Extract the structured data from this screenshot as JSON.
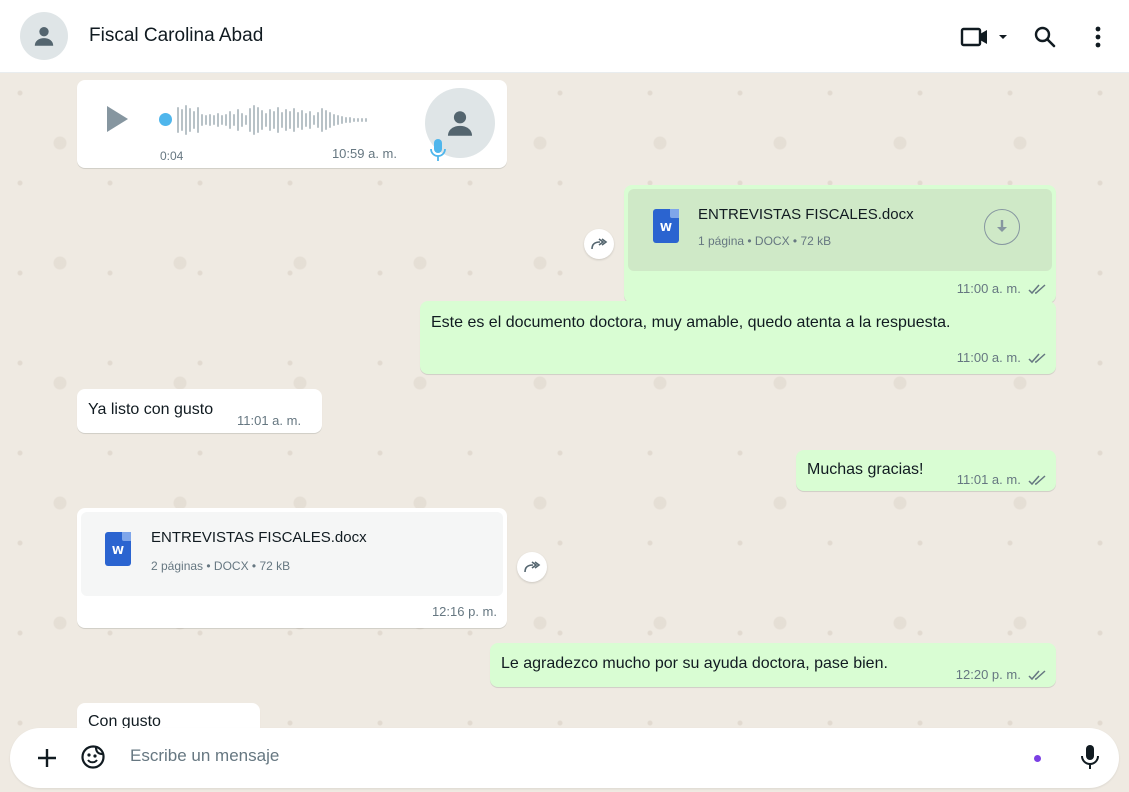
{
  "header": {
    "contact_name": "Fiscal Carolina Abad",
    "icons": [
      "default-avatar-icon",
      "video-call-icon",
      "chevron-down-icon",
      "search-icon",
      "more-vertical-icon"
    ]
  },
  "messages": [
    {
      "type": "audio",
      "direction": "in",
      "duration": "0:04",
      "time": "10:59 a. m."
    },
    {
      "type": "document",
      "direction": "out",
      "file_name": "ENTREVISTAS FISCALES.docx",
      "file_meta": "1 página • DOCX • 72 kB",
      "time": "11:00 a. m."
    },
    {
      "type": "text",
      "direction": "out",
      "text": "Este es el documento doctora, muy amable, quedo atenta a la respuesta.",
      "time": "11:00 a. m."
    },
    {
      "type": "text",
      "direction": "in",
      "text": "Ya listo con gusto",
      "time": "11:01 a. m."
    },
    {
      "type": "text",
      "direction": "out",
      "text": "Muchas gracias!",
      "time": "11:01 a. m."
    },
    {
      "type": "document",
      "direction": "in",
      "file_name": "ENTREVISTAS FISCALES.docx",
      "file_meta": "2 páginas • DOCX • 72 kB",
      "time": "12:16 p. m."
    },
    {
      "type": "text",
      "direction": "out",
      "text": "Le agradezco mucho por su ayuda doctora, pase bien.",
      "time": "12:20 p. m."
    },
    {
      "type": "text",
      "direction": "in",
      "text": "Con gusto",
      "time": ""
    }
  ],
  "composer": {
    "placeholder": "Escribe un mensaje"
  },
  "colors": {
    "outgoing_bubble": "#d9fdd3",
    "incoming_bubble": "#ffffff",
    "chat_background": "#efeae2",
    "read_ticks": "#667781",
    "audio_dot": "#4fb6ec"
  }
}
